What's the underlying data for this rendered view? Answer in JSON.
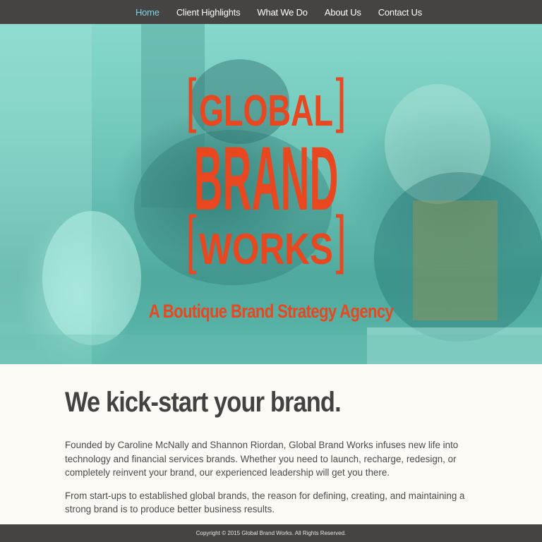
{
  "nav": {
    "items": [
      {
        "label": "Home",
        "active": true
      },
      {
        "label": "Client Highlights",
        "active": false
      },
      {
        "label": "What We Do",
        "active": false
      },
      {
        "label": "About Us",
        "active": false
      },
      {
        "label": "Contact Us",
        "active": false
      }
    ]
  },
  "hero": {
    "logo_text": [
      "GLOBAL",
      "BRAND",
      "WORKS"
    ],
    "tagline": "A Boutique Brand Strategy Agency"
  },
  "main": {
    "headline": "We kick-start your brand.",
    "paragraphs": [
      "Founded by Caroline McNally and Shannon Riordan, Global Brand Works infuses new life into technology and financial services brands. Whether you need to launch, recharge, redesign, or completely reinvent your brand, our experienced leadership will get you there.",
      "From start-ups to established global brands, the reason for defining, creating, and maintaining a strong brand is to produce better business results."
    ]
  },
  "footer": {
    "copyright": "Copyright © 2015 Global Brand Works. All Rights Reserved."
  },
  "colors": {
    "nav_bg": "#454443",
    "nav_active": "#7fd3e6",
    "hero_teal": "#6cc2b6",
    "brand_orange": "#e8471f",
    "headline": "#444240",
    "body_text": "#4a4a4a",
    "page_bg": "#fcfbf6"
  }
}
